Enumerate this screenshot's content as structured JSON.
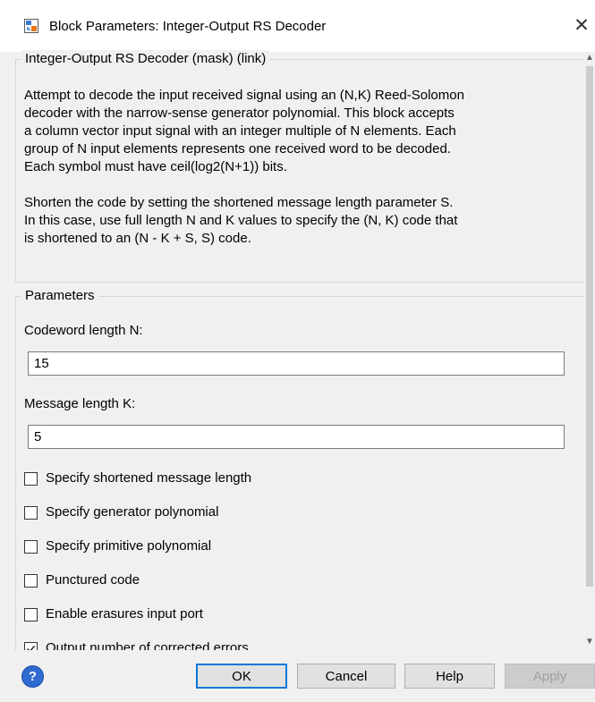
{
  "window": {
    "title": "Block Parameters: Integer-Output RS Decoder",
    "close_glyph": "✕"
  },
  "description": {
    "group_title": "Integer-Output RS Decoder (mask) (link)",
    "paragraph1_lines": [
      "Attempt to decode the input received signal using an (N,K) Reed-Solomon",
      "decoder with the narrow-sense generator polynomial.  This block accepts",
      "a column vector input signal with an integer multiple of N elements.  Each",
      "group of N input elements represents one received word to be decoded.",
      "Each symbol must have ceil(log2(N+1)) bits."
    ],
    "paragraph2_lines": [
      "Shorten the code by setting the shortened message length parameter S.",
      "In this case, use full length N and K values to specify the (N, K) code that",
      "is shortened to an (N - K + S, S) code."
    ]
  },
  "parameters": {
    "group_title": "Parameters",
    "codeword_label": "Codeword length N:",
    "codeword_value": "15",
    "message_label": "Message length K:",
    "message_value": "5",
    "checkboxes": [
      {
        "label": "Specify shortened message length",
        "checked": false
      },
      {
        "label": "Specify generator polynomial",
        "checked": false
      },
      {
        "label": "Specify primitive polynomial",
        "checked": false
      },
      {
        "label": "Punctured code",
        "checked": false
      },
      {
        "label": "Enable erasures input port",
        "checked": false
      },
      {
        "label": "Output number of corrected errors",
        "checked": true
      }
    ]
  },
  "footer": {
    "help_icon_glyph": "?",
    "ok_label": "OK",
    "cancel_label": "Cancel",
    "help_label": "Help",
    "apply_label": "Apply"
  },
  "colors": {
    "accent": "#0078d7",
    "help_icon": "#2f6bd0",
    "disabled_text": "#a0a0a0"
  }
}
